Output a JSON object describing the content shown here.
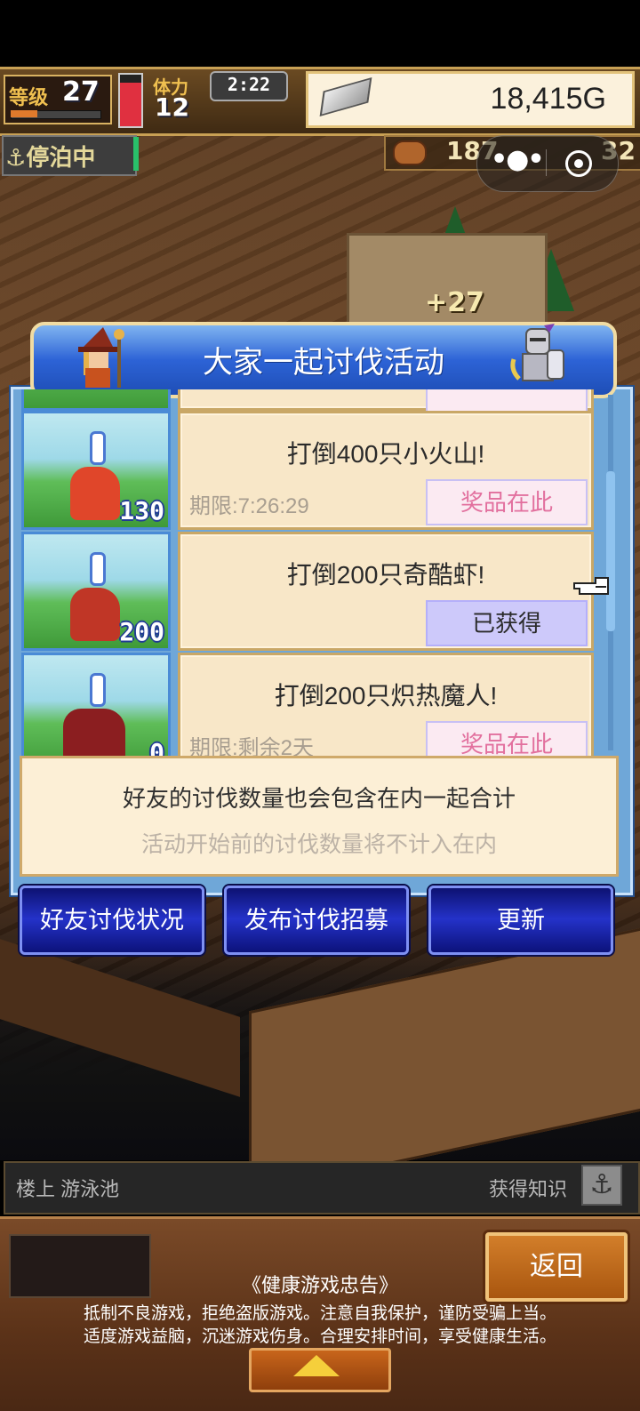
{
  "hud": {
    "level_label": "等级",
    "level_value": "27",
    "level_progress": 0.3,
    "stamina_label": "体力",
    "stamina_value": "12",
    "stamina_level": 0.85,
    "clock": "2:22",
    "gold": "18,415G",
    "moored_label": "停泊中",
    "resource_1": "187",
    "resource_2": "32"
  },
  "world": {
    "floating_bonus": "+27"
  },
  "dialog": {
    "title": "大家一起讨伐活动",
    "quests": [
      {
        "title": "打倒400只小火山!",
        "deadline": "期限:7:26:29",
        "button": "奖品在此",
        "claimed": false,
        "count": "130",
        "monster_color": "#e0462a"
      },
      {
        "title": "打倒200只奇酷虾!",
        "deadline": "",
        "button": "已获得",
        "claimed": true,
        "count": "200",
        "monster_color": "#c03626"
      },
      {
        "title": "打倒200只炽热魔人!",
        "deadline": "期限:剩余2天",
        "button": "奖品在此",
        "claimed": false,
        "count": "0",
        "monster_color": "#8b1e20"
      }
    ],
    "info_line_1": "好友的讨伐数量也会包含在内一起合计",
    "info_line_2": "活动开始前的讨伐数量将不计入在内",
    "buttons": {
      "friends": "好友讨伐状况",
      "recruit": "发布讨伐招募",
      "refresh": "更新"
    }
  },
  "bottom": {
    "location": "楼上 游泳池",
    "knowledge": "获得知识",
    "back": "返回",
    "notice_title": "《健康游戏忠告》",
    "notice_line_1": "抵制不良游戏，拒绝盗版游戏。注意自我保护，谨防受骗上当。",
    "notice_line_2": "适度游戏益脑，沉迷游戏伤身。合理安排时间，享受健康生活。"
  }
}
